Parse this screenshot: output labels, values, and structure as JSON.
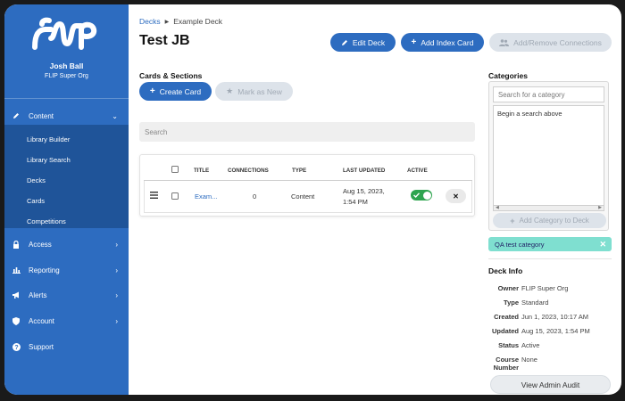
{
  "sidebar": {
    "logo_text": "FLIP",
    "user_name": "Josh Ball",
    "user_org": "FLIP Super Org",
    "nav": [
      {
        "label": "Content",
        "icon": "pencil-icon",
        "expanded": true
      },
      {
        "label": "Access",
        "icon": "lock-icon"
      },
      {
        "label": "Reporting",
        "icon": "bar-chart-icon"
      },
      {
        "label": "Alerts",
        "icon": "megaphone-icon"
      },
      {
        "label": "Account",
        "icon": "shield-icon"
      },
      {
        "label": "Support",
        "icon": "question-icon"
      }
    ],
    "submenu": [
      "Library Builder",
      "Library Search",
      "Decks",
      "Cards",
      "Competitions"
    ]
  },
  "breadcrumb": {
    "parent": "Decks",
    "current": "Example Deck"
  },
  "page_title": "Test JB",
  "header_buttons": {
    "edit_deck": "Edit Deck",
    "add_index_card": "Add Index Card",
    "add_remove_connections": "Add/Remove Connections"
  },
  "cards_section": {
    "title": "Cards & Sections",
    "create_card": "Create Card",
    "mark_as_new": "Mark as New",
    "search_placeholder": "Search",
    "columns": [
      "TITLE",
      "CONNECTIONS",
      "TYPE",
      "LAST UPDATED",
      "ACTIVE"
    ],
    "rows": [
      {
        "title": "Exam...",
        "connections": "0",
        "type": "Content",
        "last_updated_line1": "Aug 15, 2023,",
        "last_updated_line2": "1:54 PM",
        "active": true
      }
    ]
  },
  "categories": {
    "title": "Categories",
    "search_placeholder": "Search for a category",
    "list_hint": "Begin a search above",
    "add_button": "Add Category to Deck",
    "tags": [
      "QA test category"
    ]
  },
  "deck_info": {
    "title": "Deck Info",
    "fields": [
      {
        "key": "Owner",
        "value": "FLIP Super Org"
      },
      {
        "key": "Type",
        "value": "Standard"
      },
      {
        "key": "Created",
        "value": "Jun 1, 2023, 10:17 AM"
      },
      {
        "key": "Updated",
        "value": "Aug 15, 2023, 1:54 PM"
      },
      {
        "key": "Status",
        "value": "Active"
      },
      {
        "key": "Course Number",
        "value": "None"
      }
    ],
    "audit_button": "View Admin Audit"
  },
  "colors": {
    "primary": "#2d6cc0",
    "sidebar_sub": "#1f5499",
    "active_toggle": "#2ea44f",
    "tag": "#7fdfd0"
  }
}
